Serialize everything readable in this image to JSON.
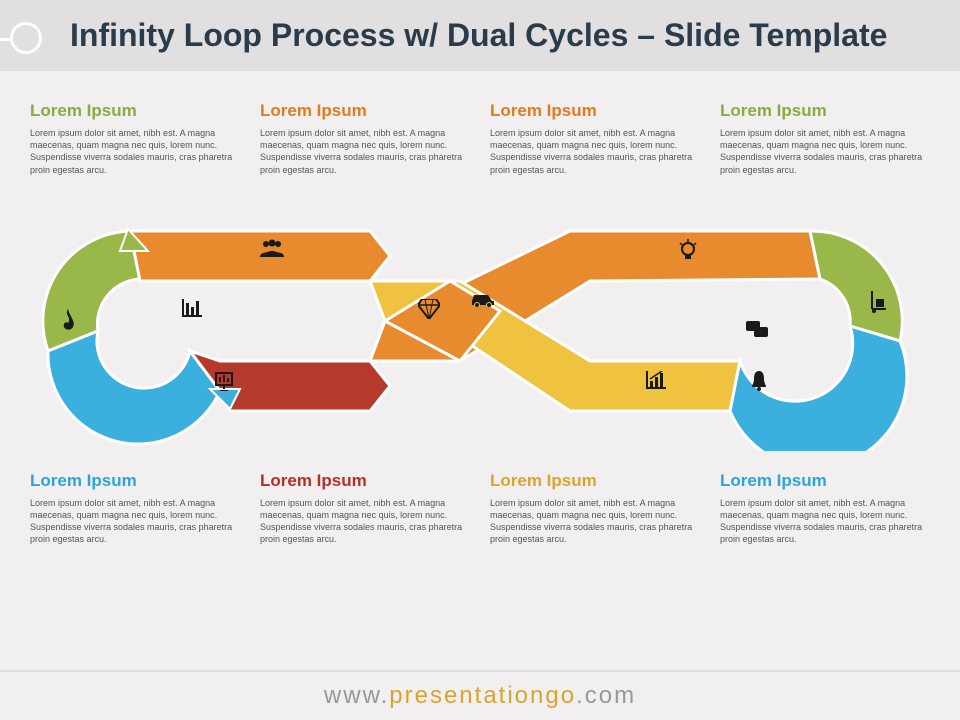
{
  "title": "Infinity Loop Process w/ Dual Cycles – Slide Template",
  "lorem": "Lorem ipsum dolor sit amet, nibh est. A magna maecenas, quam magna nec quis, lorem nunc. Suspendisse viverra sodales mauris, cras pharetra proin egestas arcu.",
  "blocks": {
    "top": [
      {
        "heading": "Lorem Ipsum",
        "colorClass": "c-green"
      },
      {
        "heading": "Lorem Ipsum",
        "colorClass": "c-orange"
      },
      {
        "heading": "Lorem Ipsum",
        "colorClass": "c-orange"
      },
      {
        "heading": "Lorem Ipsum",
        "colorClass": "c-green"
      }
    ],
    "bottom": [
      {
        "heading": "Lorem Ipsum",
        "colorClass": "c-blue"
      },
      {
        "heading": "Lorem Ipsum",
        "colorClass": "c-red"
      },
      {
        "heading": "Lorem Ipsum",
        "colorClass": "c-yellow"
      },
      {
        "heading": "Lorem Ipsum",
        "colorClass": "c-blue"
      }
    ]
  },
  "icons": {
    "flame": "flame-icon",
    "chart1": "bar-chart-icon",
    "board": "presentation-icon",
    "people": "people-icon",
    "diamond": "diamond-icon",
    "car": "car-icon",
    "bulb": "lightbulb-icon",
    "rising": "rising-chart-icon",
    "chat": "chat-icon",
    "bell": "bell-icon",
    "cart": "hand-truck-icon"
  },
  "colors": {
    "green": "#9ab84a",
    "orange": "#e88a2e",
    "blue": "#3bb0df",
    "red": "#b53a2c",
    "yellow": "#efc240"
  },
  "footer": {
    "prefix": "www.",
    "highlight": "presentationgo",
    "suffix": ".com"
  }
}
